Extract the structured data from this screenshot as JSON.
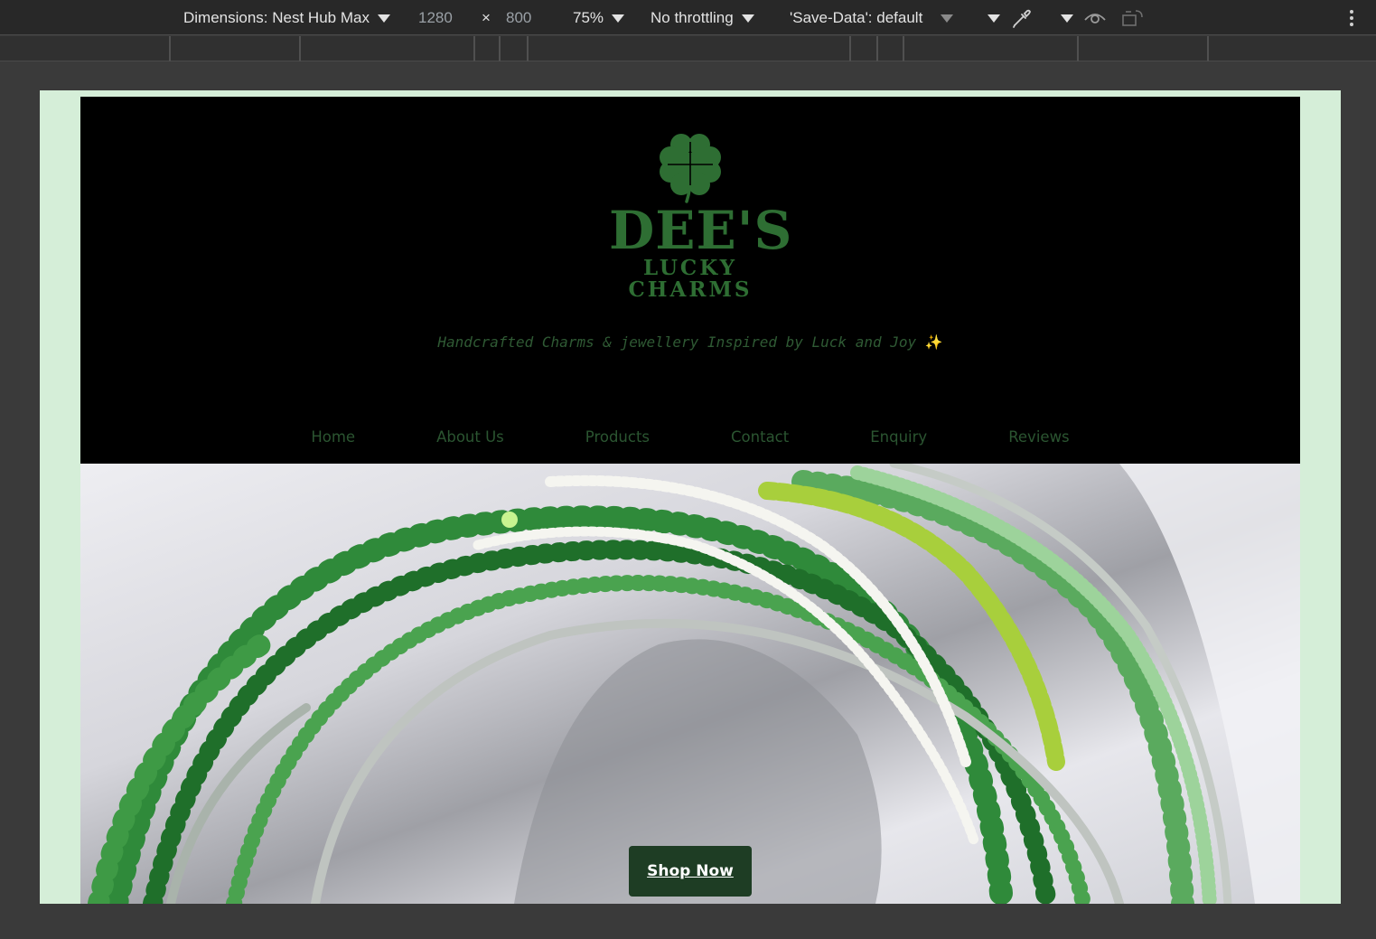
{
  "devtools": {
    "dimensions_label": "Dimensions: Nest Hub Max",
    "width": "1280",
    "times": "×",
    "height": "800",
    "zoom": "75%",
    "throttling": "No throttling",
    "save_data": "'Save-Data': default"
  },
  "site": {
    "brand_line1": "DEE'S",
    "brand_line2": "LUCKY",
    "brand_line3": "CHARMS",
    "tagline": "Handcrafted Charms & jewellery Inspired by Luck and Joy",
    "tagline_emoji": "✨",
    "nav": [
      "Home",
      "About Us",
      "Products",
      "Contact",
      "Enquiry",
      "Reviews"
    ],
    "cta": "Shop Now"
  },
  "colors": {
    "brand_green": "#2e6e33",
    "page_mint": "#d5eed8",
    "button_dark_green": "#1e3d24"
  }
}
